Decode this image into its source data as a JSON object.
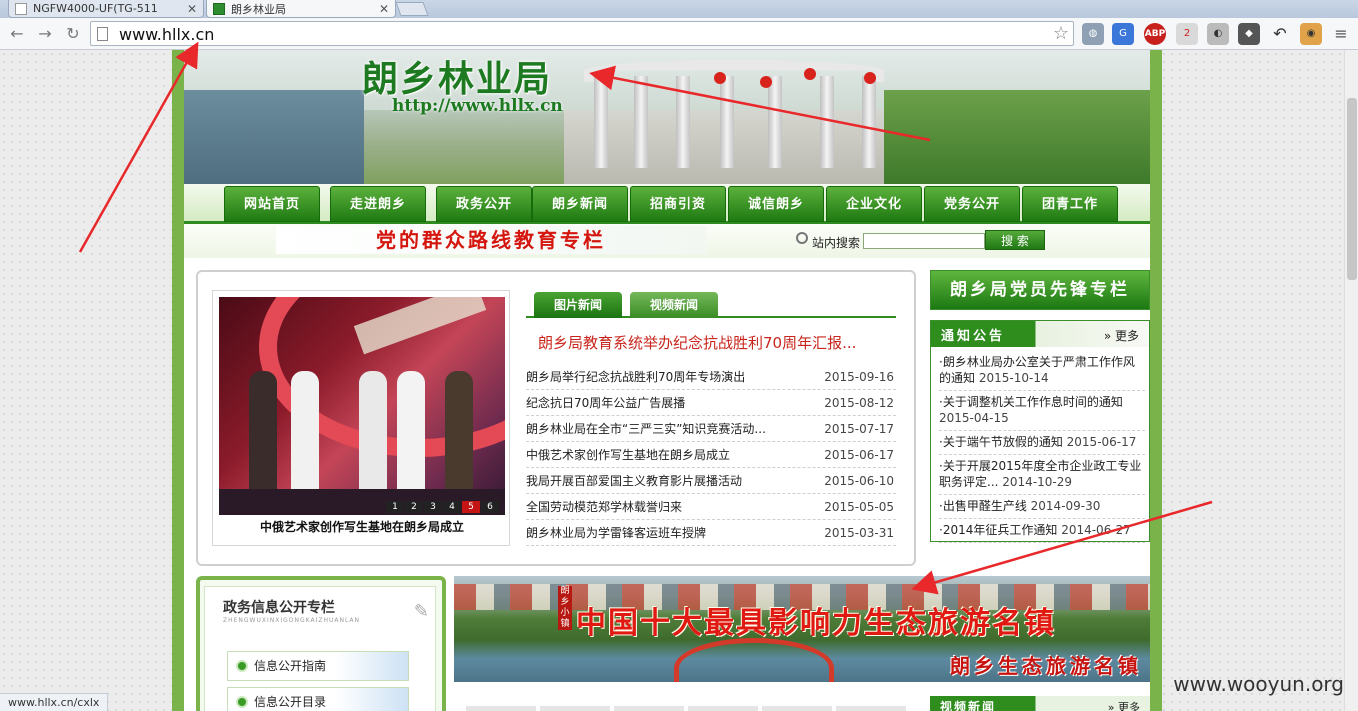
{
  "browser": {
    "tabs": [
      {
        "label": "NGFW4000-UF(TG-511",
        "active": false
      },
      {
        "label": "朗乡林业局",
        "active": true
      }
    ],
    "url": "www.hllx.cn",
    "status_url": "www.hllx.cn/cxlx",
    "extensions": [
      "globe-icon",
      "translate-icon",
      "adblock-icon",
      "extension-icon",
      "extension-icon",
      "spy-icon",
      "undo-icon",
      "extension-icon",
      "menu-icon"
    ],
    "adblock_label": "ABP",
    "ext_badge": "2"
  },
  "site": {
    "title": "朗乡林业局",
    "url_text": "http://www.hllx.cn",
    "nav": [
      "网站首页",
      "走进朗乡",
      "政务公开",
      "朗乡新闻",
      "招商引资",
      "诚信朗乡",
      "企业文化",
      "党务公开",
      "团青工作"
    ],
    "party_banner": "党的群众路线教育专栏",
    "search": {
      "label": "站内搜索",
      "button": "搜 索"
    },
    "photo": {
      "caption": "中俄艺术家创作写生基地在朗乡局成立",
      "pages": [
        "1",
        "2",
        "3",
        "4",
        "5",
        "6"
      ],
      "active_page": "5"
    },
    "news_tabs": [
      "图片新闻",
      "视频新闻"
    ],
    "headline": "朗乡局教育系统举办纪念抗战胜利70周年汇报...",
    "news": [
      {
        "title": "朗乡局举行纪念抗战胜利70周年专场演出",
        "date": "2015-09-16"
      },
      {
        "title": "纪念抗日70周年公益广告展播",
        "date": "2015-08-12"
      },
      {
        "title": "朗乡林业局在全市“三严三实”知识竞赛活动...",
        "date": "2015-07-17"
      },
      {
        "title": "中俄艺术家创作写生基地在朗乡局成立",
        "date": "2015-06-17"
      },
      {
        "title": "我局开展百部爱国主义教育影片展播活动",
        "date": "2015-06-10"
      },
      {
        "title": "全国劳动模范郑学林载誉归来",
        "date": "2015-05-05"
      },
      {
        "title": "朗乡林业局为学雷锋客运班车授牌",
        "date": "2015-03-31"
      }
    ],
    "pioneer": "朗乡局党员先锋专栏",
    "notice": {
      "title": "通知公告",
      "more": "更多",
      "items": [
        {
          "title": "·朗乡林业局办公室关于严肃工作作风的通知",
          "date": "2015-10-14"
        },
        {
          "title": "·关于调整机关工作作息时间的通知",
          "date": "2015-04-15"
        },
        {
          "title": "·关于端午节放假的通知",
          "date": "2015-06-17"
        },
        {
          "title": "·关于开展2015年度全市企业政工专业职务评定...",
          "date": "2014-10-29"
        },
        {
          "title": "·出售甲醛生产线",
          "date": "2014-09-30"
        },
        {
          "title": "·2014年征兵工作通知",
          "date": "2014-06-27"
        }
      ]
    },
    "gov": {
      "title": "政务信息公开专栏",
      "subtitle": "ZHENGWUXINXIGONGKAIZHUANLAN",
      "links": [
        "信息公开指南",
        "信息公开目录"
      ]
    },
    "tour": {
      "main": "中国十大最具影响力生态旅游名镇",
      "sub": "朗乡生态旅游名镇",
      "side": "朗乡小镇"
    },
    "video_news": {
      "title": "视频新闻",
      "more": "更多"
    }
  },
  "watermark": "www.wooyun.org",
  "colors": {
    "brand_green": "#1d7a21",
    "accent_red": "#d4160f",
    "annotation_red": "#e8282a"
  }
}
